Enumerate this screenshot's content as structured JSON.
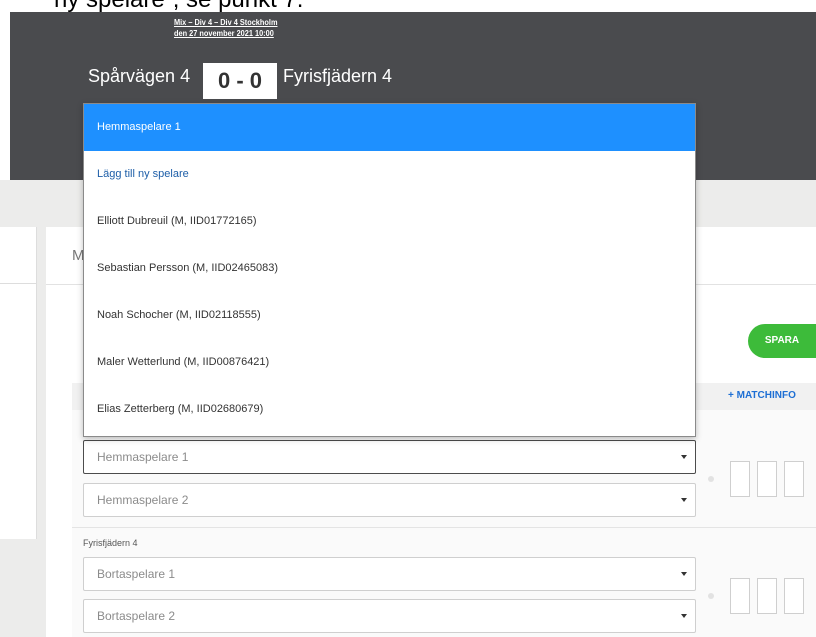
{
  "caption": {
    "text": "ny spelare”, se punkt 7."
  },
  "match": {
    "competition": "Mix – Div 4 – Div 4 Stockholm",
    "datetime": "den 27 november 2021 10:00",
    "home_team": "Spårvägen 4",
    "away_team": "Fyrisfjädern 4",
    "score": "0 - 0"
  },
  "tab": {
    "partial_label": "M"
  },
  "actions": {
    "save_label": "SPARA",
    "matchinfo_label": "+ MATCHINFO"
  },
  "dropdown": {
    "options": [
      "Hemmaspelare 1",
      "Lägg till ny spelare",
      "Elliott Dubreuil (M, IID01772165)",
      "Sebastian Persson (M, IID02465083)",
      "Noah Schocher (M, IID02118555)",
      "Maler Wetterlund (M, IID00876421)",
      "Elias Zetterberg (M, IID02680679)"
    ],
    "selected_index": 0
  },
  "form": {
    "home_player_1": "Hemmaspelare 1",
    "home_player_2": "Hemmaspelare 2",
    "away_section_label": "Fyrisfjädern 4",
    "away_player_1": "Bortaspelare 1",
    "away_player_2": "Bortaspelare 2"
  },
  "colors": {
    "header_bg": "#4a4b4e",
    "accent_blue": "#1e90ff",
    "save_green": "#3dbb3a",
    "link_blue": "#1d5ea8"
  }
}
